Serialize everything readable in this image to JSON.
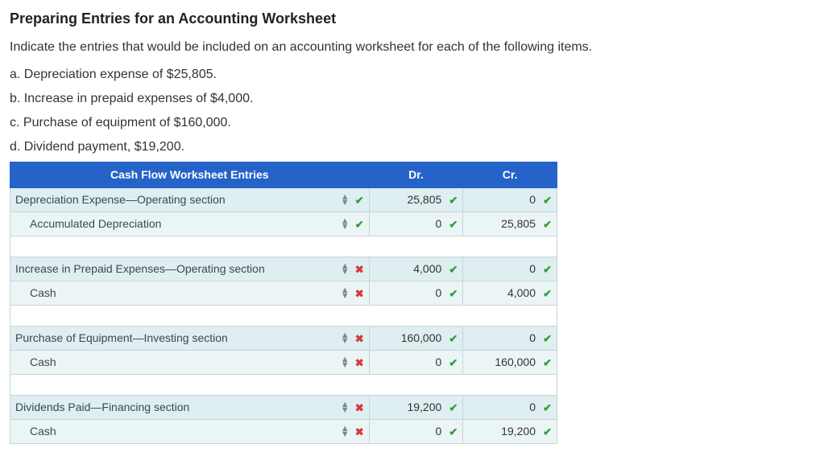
{
  "title": "Preparing Entries for an Accounting Worksheet",
  "intro": "Indicate the entries that would be included on an accounting worksheet for each of the following items.",
  "items": {
    "a": "a. Depreciation expense of $25,805.",
    "b": "b. Increase in prepaid expenses of $4,000.",
    "c": "c. Purchase of equipment of $160,000.",
    "d": "d. Dividend payment, $19,200."
  },
  "headers": {
    "entries": "Cash Flow Worksheet Entries",
    "dr": "Dr.",
    "cr": "Cr."
  },
  "rows": [
    {
      "label": "Depreciation Expense—Operating section",
      "indent": false,
      "row_mark": "ok",
      "dr": "25,805",
      "dr_mark": "ok",
      "cr": "0",
      "cr_mark": "ok"
    },
    {
      "label": "Accumulated Depreciation",
      "indent": true,
      "row_mark": "ok",
      "dr": "0",
      "dr_mark": "ok",
      "cr": "25,805",
      "cr_mark": "ok"
    },
    {
      "spacer": true
    },
    {
      "label": "Increase in Prepaid Expenses—Operating section",
      "indent": false,
      "row_mark": "bad",
      "dr": "4,000",
      "dr_mark": "ok",
      "cr": "0",
      "cr_mark": "ok"
    },
    {
      "label": "Cash",
      "indent": true,
      "row_mark": "bad",
      "dr": "0",
      "dr_mark": "ok",
      "cr": "4,000",
      "cr_mark": "ok"
    },
    {
      "spacer": true
    },
    {
      "label": "Purchase of Equipment—Investing section",
      "indent": false,
      "row_mark": "bad",
      "dr": "160,000",
      "dr_mark": "ok",
      "cr": "0",
      "cr_mark": "ok"
    },
    {
      "label": "Cash",
      "indent": true,
      "row_mark": "bad",
      "dr": "0",
      "dr_mark": "ok",
      "cr": "160,000",
      "cr_mark": "ok"
    },
    {
      "spacer": true
    },
    {
      "label": "Dividends Paid—Financing section",
      "indent": false,
      "row_mark": "bad",
      "dr": "19,200",
      "dr_mark": "ok",
      "cr": "0",
      "cr_mark": "ok"
    },
    {
      "label": "Cash",
      "indent": true,
      "row_mark": "bad",
      "dr": "0",
      "dr_mark": "ok",
      "cr": "19,200",
      "cr_mark": "ok"
    }
  ],
  "glyphs": {
    "ok": "✔",
    "bad": "✖",
    "up": "▲",
    "down": "▼"
  }
}
